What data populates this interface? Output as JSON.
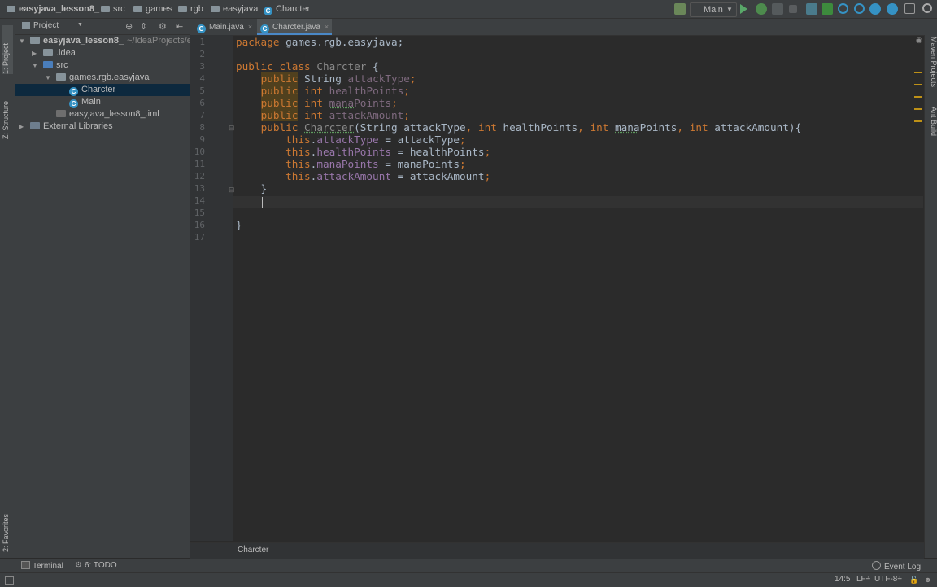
{
  "breadcrumbs": [
    "easyjava_lesson8_",
    "src",
    "games",
    "rgb",
    "easyjava",
    "Charcter"
  ],
  "run_config": "Main",
  "toolbar": {
    "icons": [
      "build-icon",
      "run-icon",
      "debug-icon",
      "coverage-icon",
      "stop-icon",
      "structure-icon",
      "vcs-commit-icon",
      "search-icon",
      "update-icon",
      "help-icon",
      "info-icon",
      "project-structure-icon",
      "search-everywhere-icon"
    ]
  },
  "left_stripe": {
    "project": "1: Project",
    "structure": "Z: Structure",
    "favorites": "2: Favorites"
  },
  "project_panel": {
    "title": "Project",
    "tree": [
      {
        "label": "easyjava_lesson8_",
        "suffix": "~/IdeaProjects/e",
        "depth": 0,
        "arrow": "▼",
        "icon": "module"
      },
      {
        "label": ".idea",
        "depth": 1,
        "arrow": "▶",
        "icon": "folder"
      },
      {
        "label": "src",
        "depth": 1,
        "arrow": "▼",
        "icon": "src-folder"
      },
      {
        "label": "games.rgb.easyjava",
        "depth": 2,
        "arrow": "▼",
        "icon": "package"
      },
      {
        "label": "Charcter",
        "depth": 3,
        "arrow": "",
        "icon": "class",
        "selected": true
      },
      {
        "label": "Main",
        "depth": 3,
        "arrow": "",
        "icon": "class"
      },
      {
        "label": "easyjava_lesson8_.iml",
        "depth": 2,
        "arrow": "",
        "icon": "iml"
      },
      {
        "label": "External Libraries",
        "depth": 0,
        "arrow": "▶",
        "icon": "library"
      }
    ]
  },
  "editor_tabs": [
    {
      "label": "Main.java",
      "active": false
    },
    {
      "label": "Charcter.java",
      "active": true
    }
  ],
  "code": {
    "line_numbers": [
      "1",
      "2",
      "3",
      "4",
      "5",
      "6",
      "7",
      "8",
      "9",
      "10",
      "11",
      "12",
      "13",
      "14",
      "15",
      "16",
      "17"
    ]
  },
  "editor_breadcrumb": "Charcter",
  "right_stripe": {
    "maven": "Maven Projects",
    "ant": "Ant Build"
  },
  "bottom_tools": {
    "terminal": "Terminal",
    "todo": "6: TODO",
    "event_log": "Event Log"
  },
  "status": {
    "position": "14:5",
    "line_sep": "LF÷",
    "encoding": "UTF-8÷"
  },
  "colors": {
    "background": "#2b2b2b",
    "panel": "#3c3f41",
    "keyword": "#cc7832",
    "field": "#9876aa",
    "selection": "#0d293e"
  }
}
